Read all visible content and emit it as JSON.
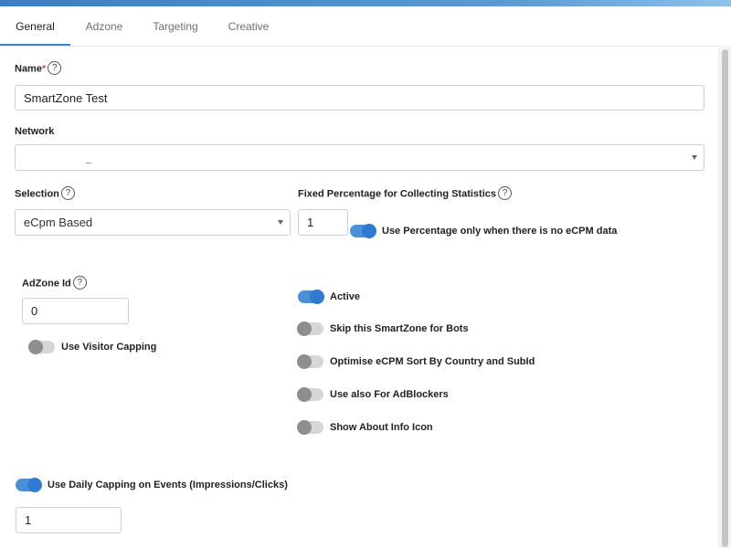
{
  "tabs": [
    {
      "label": "General",
      "active": true
    },
    {
      "label": "Adzone",
      "active": false
    },
    {
      "label": "Targeting",
      "active": false
    },
    {
      "label": "Creative",
      "active": false
    }
  ],
  "form": {
    "name": {
      "label": "Name",
      "required_mark": "*",
      "value": "SmartZone Test"
    },
    "network": {
      "label": "Network",
      "value": ""
    },
    "selection": {
      "label": "Selection",
      "value": "eCpm Based"
    },
    "fixed_percentage": {
      "label": "Fixed Percentage for Collecting Statistics",
      "value": "1"
    },
    "use_percentage_toggle": {
      "label": "Use Percentage only when there is no eCPM data",
      "on": true
    },
    "adzone_id": {
      "label": "AdZone Id",
      "value": "0"
    },
    "visitor_capping_toggle": {
      "label": "Use Visitor Capping",
      "on": false
    },
    "active_toggle": {
      "label": "Active",
      "on": true
    },
    "skip_bots_toggle": {
      "label": "Skip this SmartZone for Bots",
      "on": false
    },
    "optimise_toggle": {
      "label": "Optimise eCPM Sort By Country and SubId",
      "on": false
    },
    "adblockers_toggle": {
      "label": "Use also For AdBlockers",
      "on": false
    },
    "info_icon_toggle": {
      "label": "Show About Info Icon",
      "on": false
    },
    "daily_capping_toggle": {
      "label": "Use Daily Capping on Events (Impressions/Clicks)",
      "on": true
    },
    "daily_capping_value": "1"
  },
  "help_glyph": "?",
  "colors": {
    "accent": "#4a90d9",
    "required": "#d9534f",
    "toggle_off": "#d6d6d6"
  }
}
